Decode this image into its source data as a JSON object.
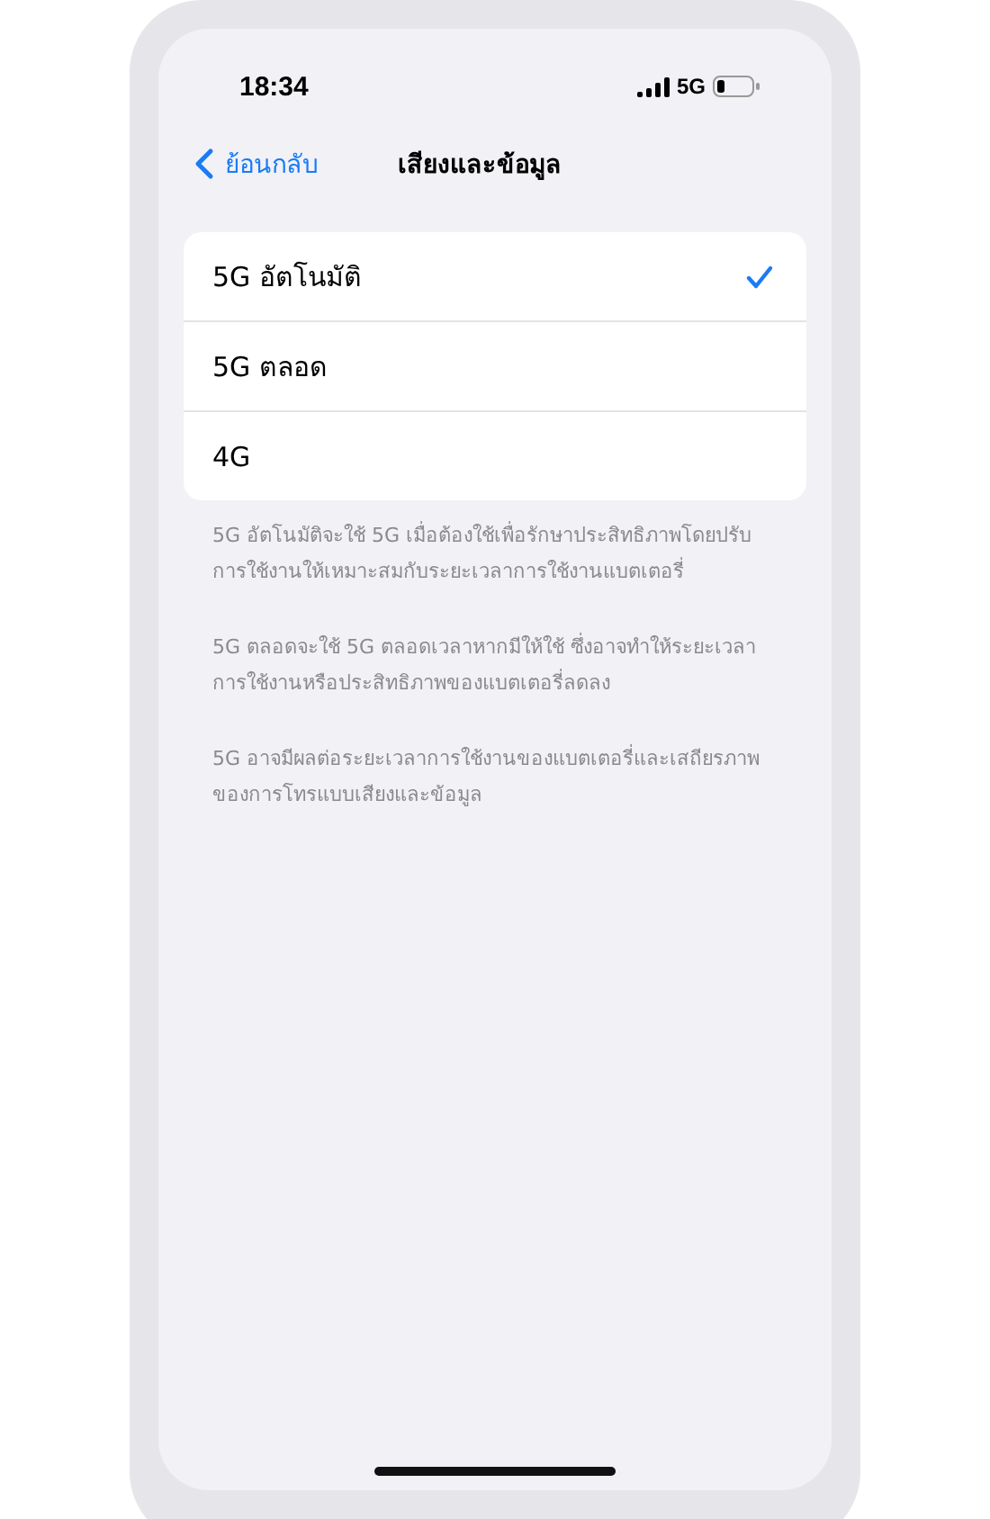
{
  "status_bar": {
    "time": "18:34",
    "network": "5G"
  },
  "nav": {
    "back": "ย้อนกลับ",
    "title": "เสียงและข้อมูล"
  },
  "options": [
    {
      "label": "5G อัตโนมัติ",
      "selected": true
    },
    {
      "label": "5G ตลอด",
      "selected": false
    },
    {
      "label": "4G",
      "selected": false
    }
  ],
  "notes": [
    "5G อัตโนมัติจะใช้ 5G เมื่อต้องใช้เพื่อรักษาประสิทธิภาพโดยปรับการใช้งานให้เหมาะสมกับระยะเวลาการใช้งานแบตเตอรี่",
    "5G ตลอดจะใช้ 5G ตลอดเวลาหากมีให้ใช้ ซึ่งอาจทำให้ระยะเวลาการใช้งานหรือประสิทธิภาพของแบตเตอรี่ลดลง",
    "5G อาจมีผลต่อระยะเวลาการใช้งานของแบตเตอรี่และเสถียรภาพของการโทรแบบเสียงและข้อมูล"
  ]
}
